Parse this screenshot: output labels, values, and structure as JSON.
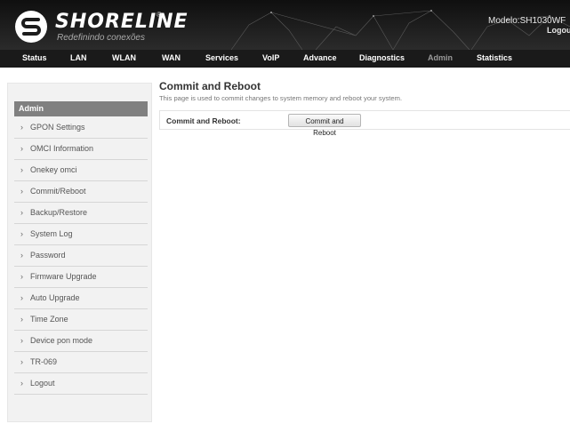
{
  "header": {
    "brand": "SHORELINE",
    "registered": "®",
    "tagline": "Redefinindo conexões",
    "model": "Modelo:SH1030WF",
    "logout": "Logout"
  },
  "nav": {
    "items": [
      "Status",
      "LAN",
      "WLAN",
      "WAN",
      "Services",
      "VoIP",
      "Advance",
      "Diagnostics",
      "Admin",
      "Statistics"
    ],
    "active": "Admin"
  },
  "sidebar": {
    "title": "Admin",
    "items": [
      {
        "label": "GPON Settings"
      },
      {
        "label": "OMCI Information"
      },
      {
        "label": "Onekey omci"
      },
      {
        "label": "Commit/Reboot"
      },
      {
        "label": "Backup/Restore"
      },
      {
        "label": "System Log"
      },
      {
        "label": "Password"
      },
      {
        "label": "Firmware Upgrade"
      },
      {
        "label": "Auto Upgrade"
      },
      {
        "label": "Time Zone"
      },
      {
        "label": "Device pon mode"
      },
      {
        "label": "TR-069"
      },
      {
        "label": "Logout"
      }
    ],
    "arrow": "›"
  },
  "main": {
    "title": "Commit and Reboot",
    "description": "This page is used to commit changes to system memory and reboot your system.",
    "form_label": "Commit and Reboot:",
    "button_label": "Commit and Reboot"
  },
  "colors": {
    "header_bg": "#1c1c1c",
    "sidebar_head_bg": "#808080",
    "active_nav": "#9a9a9a"
  }
}
